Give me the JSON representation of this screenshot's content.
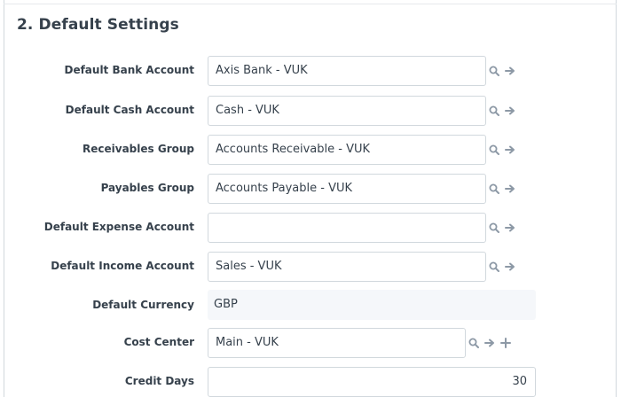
{
  "section": {
    "title": "2. Default Settings"
  },
  "fields": [
    {
      "label": "Default Bank Account",
      "value": "Axis Bank - VUK"
    },
    {
      "label": "Default Cash Account",
      "value": "Cash - VUK"
    },
    {
      "label": "Receivables Group",
      "value": "Accounts Receivable - VUK"
    },
    {
      "label": "Payables Group",
      "value": "Accounts Payable - VUK"
    },
    {
      "label": "Default Expense Account",
      "value": ""
    },
    {
      "label": "Default Income Account",
      "value": "Sales - VUK"
    },
    {
      "label": "Default Currency",
      "value": "GBP"
    },
    {
      "label": "Cost Center",
      "value": "Main - VUK"
    },
    {
      "label": "Credit Days",
      "value": "30"
    }
  ],
  "icons": {
    "search": "search-icon",
    "open": "arrow-right-icon",
    "add": "plus-icon"
  },
  "colors": {
    "text": "#36414c",
    "icon": "#8d99a6",
    "border": "#d1d8dd",
    "readonly_bg": "#f5f7fa"
  }
}
